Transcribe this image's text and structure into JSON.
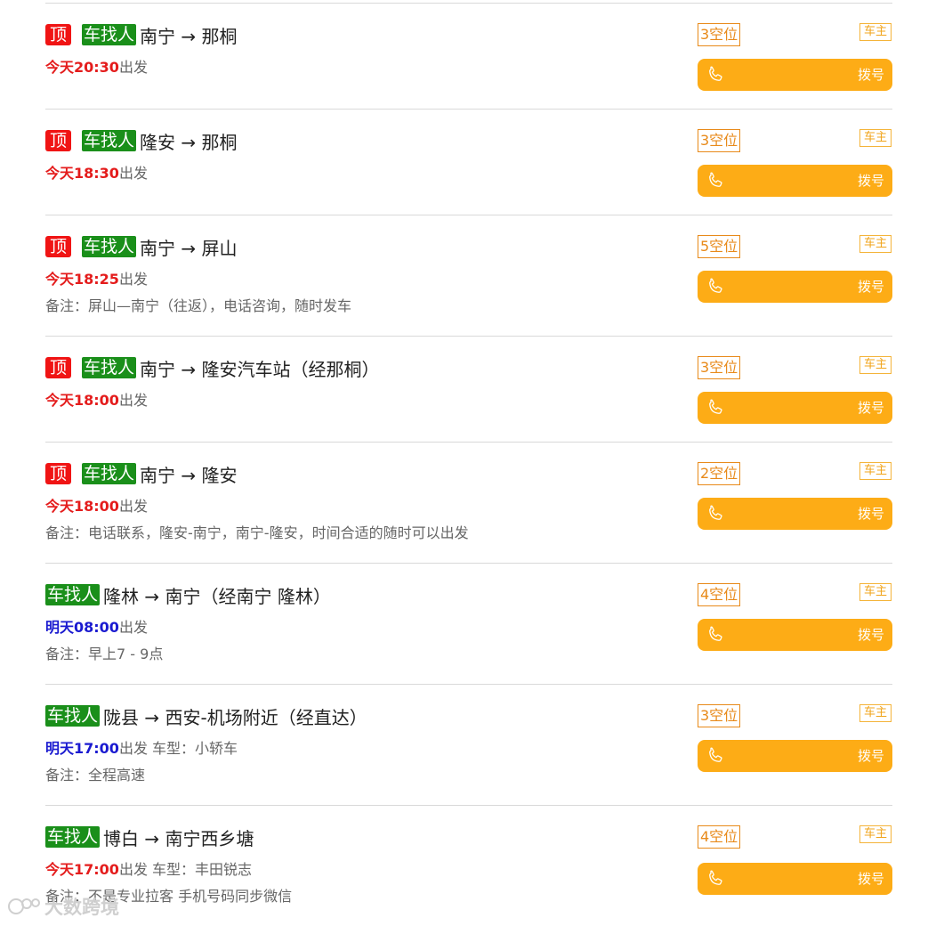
{
  "labels": {
    "top_badge": "顶",
    "seek_badge": "车找人",
    "arrow": "→",
    "depart_suffix": "出发",
    "note_prefix": "备注：",
    "owner_badge": "车主",
    "dial_label": "拨号"
  },
  "trips": [
    {
      "pinned": true,
      "from": "南宁",
      "to": "那桐",
      "day": "today",
      "time": "今天20:30",
      "extra": "",
      "note": "",
      "seats": "3空位"
    },
    {
      "pinned": true,
      "from": "隆安",
      "to": "那桐",
      "day": "today",
      "time": "今天18:30",
      "extra": "",
      "note": "",
      "seats": "3空位"
    },
    {
      "pinned": true,
      "from": "南宁",
      "to": "屏山",
      "day": "today",
      "time": "今天18:25",
      "extra": "",
      "note": "屏山—南宁（往返），电话咨询，随时发车",
      "seats": "5空位"
    },
    {
      "pinned": true,
      "from": "南宁",
      "to": "隆安汽车站（经那桐）",
      "day": "today",
      "time": "今天18:00",
      "extra": "",
      "note": "",
      "seats": "3空位"
    },
    {
      "pinned": true,
      "from": "南宁",
      "to": "隆安",
      "day": "today",
      "time": "今天18:00",
      "extra": "",
      "note": "电话联系，隆安-南宁，南宁-隆安，时间合适的随时可以出发",
      "seats": "2空位"
    },
    {
      "pinned": false,
      "from": "隆林",
      "to": "南宁（经南宁 隆林）",
      "day": "tomorrow",
      "time": "明天08:00",
      "extra": "",
      "note": "早上7 - 9点",
      "seats": "4空位"
    },
    {
      "pinned": false,
      "from": "陇县",
      "to": "西安-机场附近（经直达）",
      "day": "tomorrow",
      "time": "明天17:00",
      "extra": " 车型：小轿车",
      "note": "全程高速",
      "seats": "3空位"
    },
    {
      "pinned": false,
      "from": "博白",
      "to": "南宁西乡塘",
      "day": "today",
      "time": "今天17:00",
      "extra": " 车型：丰田锐志",
      "note": "不是专业拉客 手机号码同步微信",
      "seats": "4空位"
    }
  ],
  "watermark": "大数跨境",
  "colors": {
    "pinned_red": "#f01414",
    "seek_green": "#1a8f1a",
    "today_red": "#e41c1c",
    "tomorrow_blue": "#1a1ad0",
    "accent_orange": "#fdac16",
    "seats_orange": "#e88a1a"
  },
  "icons": {
    "dial": "phone-icon",
    "watermark": "logo-icon"
  }
}
